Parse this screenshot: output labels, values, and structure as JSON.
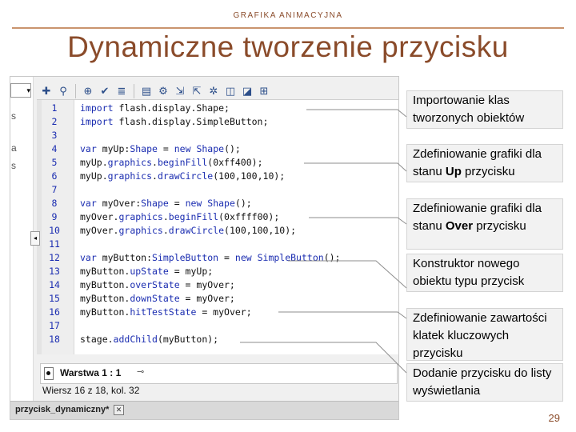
{
  "slide": {
    "header": "GRAFIKA ANIMACYJNA",
    "title": "Dynamiczne tworzenie przycisku",
    "page_number": "29"
  },
  "ide": {
    "toolbar_icons": [
      "add-icon",
      "find-icon",
      "target-icon",
      "check-syntax-icon",
      "format-icon",
      "snippets-icon",
      "debug-icon",
      "collapse-icon",
      "expand-icon",
      "comment-icon",
      "uncomment-icon",
      "help-icon"
    ],
    "left_fragments": [
      "s",
      "a",
      "s"
    ],
    "code_lines": [
      {
        "num": "1",
        "parts": [
          {
            "t": "import ",
            "c": "kw"
          },
          {
            "t": "flash.display.Shape;",
            "c": ""
          }
        ]
      },
      {
        "num": "2",
        "parts": [
          {
            "t": "import ",
            "c": "kw"
          },
          {
            "t": "flash.display.SimpleButton;",
            "c": ""
          }
        ]
      },
      {
        "num": "3",
        "parts": []
      },
      {
        "num": "4",
        "parts": [
          {
            "t": "var ",
            "c": "kw"
          },
          {
            "t": "myUp:",
            "c": ""
          },
          {
            "t": "Shape",
            "c": "ty"
          },
          {
            "t": " = ",
            "c": ""
          },
          {
            "t": "new ",
            "c": "kw"
          },
          {
            "t": "Shape",
            "c": "ty"
          },
          {
            "t": "();",
            "c": ""
          }
        ]
      },
      {
        "num": "5",
        "parts": [
          {
            "t": "myUp.",
            "c": ""
          },
          {
            "t": "graphics",
            "c": "pr"
          },
          {
            "t": ".",
            "c": ""
          },
          {
            "t": "beginFill",
            "c": "pr"
          },
          {
            "t": "(0xff400);",
            "c": ""
          }
        ]
      },
      {
        "num": "6",
        "parts": [
          {
            "t": "myUp.",
            "c": ""
          },
          {
            "t": "graphics",
            "c": "pr"
          },
          {
            "t": ".",
            "c": ""
          },
          {
            "t": "drawCircle",
            "c": "pr"
          },
          {
            "t": "(100,100,10);",
            "c": ""
          }
        ]
      },
      {
        "num": "7",
        "parts": []
      },
      {
        "num": "8",
        "parts": [
          {
            "t": "var ",
            "c": "kw"
          },
          {
            "t": "myOver:",
            "c": ""
          },
          {
            "t": "Shape",
            "c": "ty"
          },
          {
            "t": " = ",
            "c": ""
          },
          {
            "t": "new ",
            "c": "kw"
          },
          {
            "t": "Shape",
            "c": "ty"
          },
          {
            "t": "();",
            "c": ""
          }
        ]
      },
      {
        "num": "9",
        "parts": [
          {
            "t": "myOver.",
            "c": ""
          },
          {
            "t": "graphics",
            "c": "pr"
          },
          {
            "t": ".",
            "c": ""
          },
          {
            "t": "beginFill",
            "c": "pr"
          },
          {
            "t": "(0xffff00);",
            "c": ""
          }
        ]
      },
      {
        "num": "10",
        "parts": [
          {
            "t": "myOver.",
            "c": ""
          },
          {
            "t": "graphics",
            "c": "pr"
          },
          {
            "t": ".",
            "c": ""
          },
          {
            "t": "drawCircle",
            "c": "pr"
          },
          {
            "t": "(100,100,10);",
            "c": ""
          }
        ]
      },
      {
        "num": "11",
        "parts": []
      },
      {
        "num": "12",
        "parts": [
          {
            "t": "var ",
            "c": "kw"
          },
          {
            "t": "myButton:",
            "c": ""
          },
          {
            "t": "SimpleButton",
            "c": "ty"
          },
          {
            "t": " = ",
            "c": ""
          },
          {
            "t": "new ",
            "c": "kw"
          },
          {
            "t": "SimpleButton",
            "c": "ty"
          },
          {
            "t": "();",
            "c": ""
          }
        ]
      },
      {
        "num": "13",
        "parts": [
          {
            "t": "myButton.",
            "c": ""
          },
          {
            "t": "upState",
            "c": "pr"
          },
          {
            "t": " = myUp;",
            "c": ""
          }
        ]
      },
      {
        "num": "14",
        "parts": [
          {
            "t": "myButton.",
            "c": ""
          },
          {
            "t": "overState",
            "c": "pr"
          },
          {
            "t": " = myOver;",
            "c": ""
          }
        ]
      },
      {
        "num": "15",
        "parts": [
          {
            "t": "myButton.",
            "c": ""
          },
          {
            "t": "downState",
            "c": "pr"
          },
          {
            "t": " = myOver;",
            "c": ""
          }
        ]
      },
      {
        "num": "16",
        "parts": [
          {
            "t": "myButton.",
            "c": ""
          },
          {
            "t": "hitTestState",
            "c": "pr"
          },
          {
            "t": " = myOver;",
            "c": ""
          }
        ]
      },
      {
        "num": "17",
        "parts": []
      },
      {
        "num": "18",
        "parts": [
          {
            "t": "stage.",
            "c": ""
          },
          {
            "t": "addChild",
            "c": "pr"
          },
          {
            "t": "(myButton);",
            "c": ""
          }
        ]
      }
    ],
    "layer_tab": "Warstwa 1 : 1",
    "status": "Wiersz 16 z 18, kol. 32",
    "doc_tab": "przycisk_dynamiczny*",
    "doc_close": "✕"
  },
  "annotations": [
    {
      "parts": [
        {
          "t": "Importowanie klas tworzonych obiektów",
          "b": false
        }
      ]
    },
    {
      "parts": [
        {
          "t": "Zdefiniowanie grafiki dla stanu ",
          "b": false
        },
        {
          "t": "Up",
          "b": true
        },
        {
          "t": " przycisku",
          "b": false
        }
      ]
    },
    {
      "parts": [
        {
          "t": "Zdefiniowanie grafiki dla stanu ",
          "b": false
        },
        {
          "t": "Over",
          "b": true
        },
        {
          "t": " przycisku",
          "b": false
        }
      ]
    },
    {
      "parts": [
        {
          "t": "Konstruktor nowego obiektu typu przycisk",
          "b": false
        }
      ]
    },
    {
      "parts": [
        {
          "t": "Zdefiniowanie zawartości klatek kluczowych przycisku",
          "b": false
        }
      ]
    },
    {
      "parts": [
        {
          "t": "Dodanie przycisku do listy wyświetlania",
          "b": false
        }
      ]
    }
  ]
}
